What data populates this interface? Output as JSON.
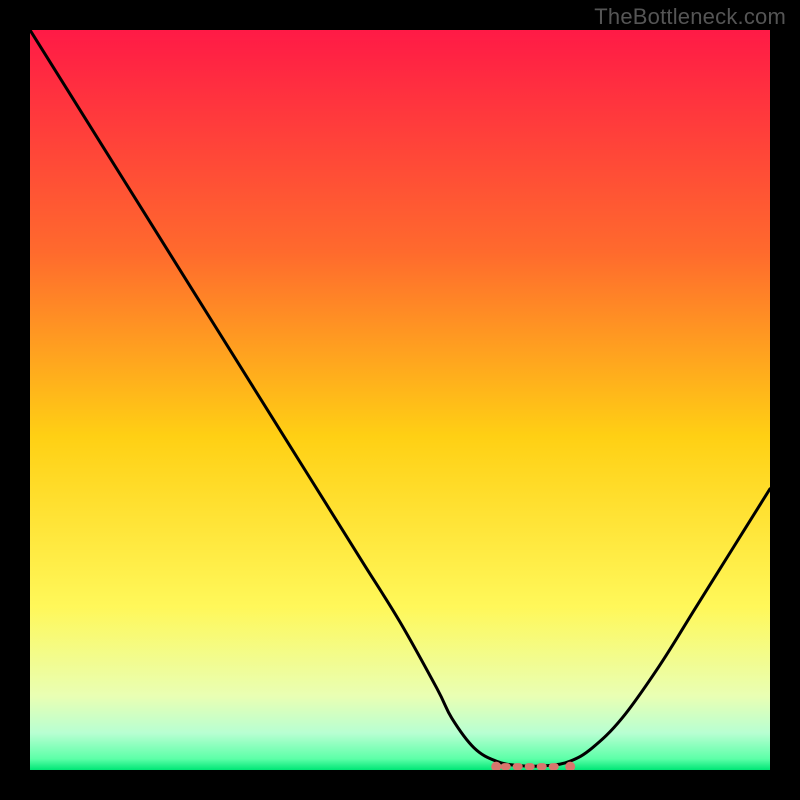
{
  "watermark": "TheBottleneck.com",
  "chart_data": {
    "type": "line",
    "title": "",
    "xlabel": "",
    "ylabel": "",
    "xlim": [
      0,
      100
    ],
    "ylim": [
      0,
      100
    ],
    "grid": false,
    "legend": false,
    "x": [
      0,
      5,
      10,
      15,
      20,
      25,
      30,
      35,
      40,
      45,
      50,
      55,
      57,
      60,
      63,
      66,
      70,
      73,
      76,
      80,
      85,
      90,
      95,
      100
    ],
    "y": [
      100,
      92,
      84,
      76,
      68,
      60,
      52,
      44,
      36,
      28,
      20,
      11,
      7,
      3,
      1.2,
      0.6,
      0.6,
      1.2,
      3,
      7,
      14,
      22,
      30,
      38
    ],
    "min_marker": {
      "x_start": 63,
      "x_end": 73,
      "y": 1
    },
    "gradient_stops": [
      {
        "offset": 0.0,
        "color": "#ff1a46"
      },
      {
        "offset": 0.3,
        "color": "#ff6a2d"
      },
      {
        "offset": 0.55,
        "color": "#ffd014"
      },
      {
        "offset": 0.78,
        "color": "#fff85a"
      },
      {
        "offset": 0.9,
        "color": "#e9ffb3"
      },
      {
        "offset": 0.95,
        "color": "#b8ffd2"
      },
      {
        "offset": 0.985,
        "color": "#5cffa8"
      },
      {
        "offset": 1.0,
        "color": "#00e676"
      }
    ]
  }
}
